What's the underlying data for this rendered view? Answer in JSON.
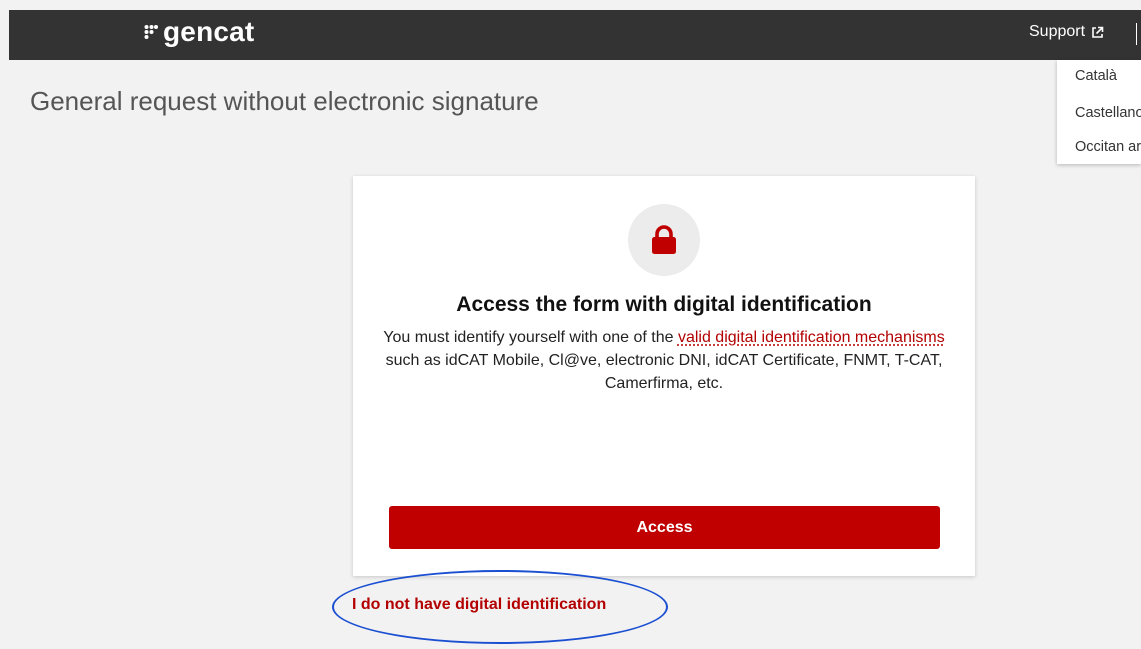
{
  "header": {
    "logo_text": "gencat",
    "support_label": "Support",
    "support_icon": "external-link-icon"
  },
  "language_menu": {
    "items": [
      {
        "label": "Català"
      },
      {
        "label": "Castellano"
      },
      {
        "label": "Occitan aranés"
      }
    ]
  },
  "page": {
    "title": "General request without electronic signature"
  },
  "card": {
    "icon": "lock-icon",
    "title": "Access the form with digital identification",
    "description_prefix": "You must identify yourself with one of the ",
    "description_link": "valid digital identification mechanisms",
    "description_suffix": " such as idCAT Mobile, Cl@ve, electronic DNI, idCAT Certificate, FNMT, T-CAT, Camerfirma, etc.",
    "access_button_label": "Access"
  },
  "no_id_link_label": "I do not have digital identification",
  "colors": {
    "header_bg": "#333333",
    "accent_red": "#c00000",
    "link_red": "#b30000",
    "annotation_blue": "#1a4fd1",
    "page_bg": "#f2f2f2"
  }
}
